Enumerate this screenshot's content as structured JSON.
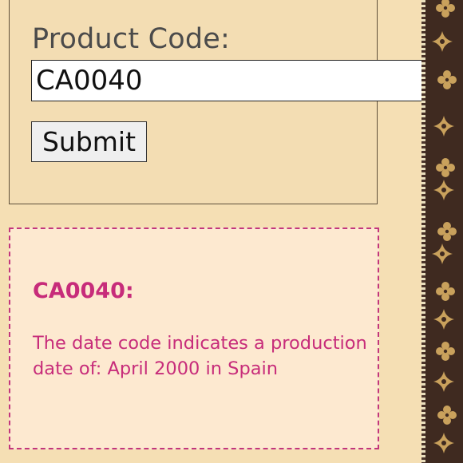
{
  "form": {
    "label": "Product Code:",
    "input_value": "CA0040",
    "submit_label": "Submit"
  },
  "result": {
    "code_heading": "CA0040:",
    "message": "The date code indicates a production date of: April 2000 in Spain"
  },
  "colors": {
    "page_background": "#f5dfb4",
    "result_text": "#c72c7a",
    "result_border": "#c2367d",
    "pattern_background": "#3f2a20",
    "pattern_motif": "#c9a15c"
  },
  "decor": {
    "pattern_icons": [
      "quatrefoil-flower-icon",
      "four-point-star-icon"
    ]
  }
}
